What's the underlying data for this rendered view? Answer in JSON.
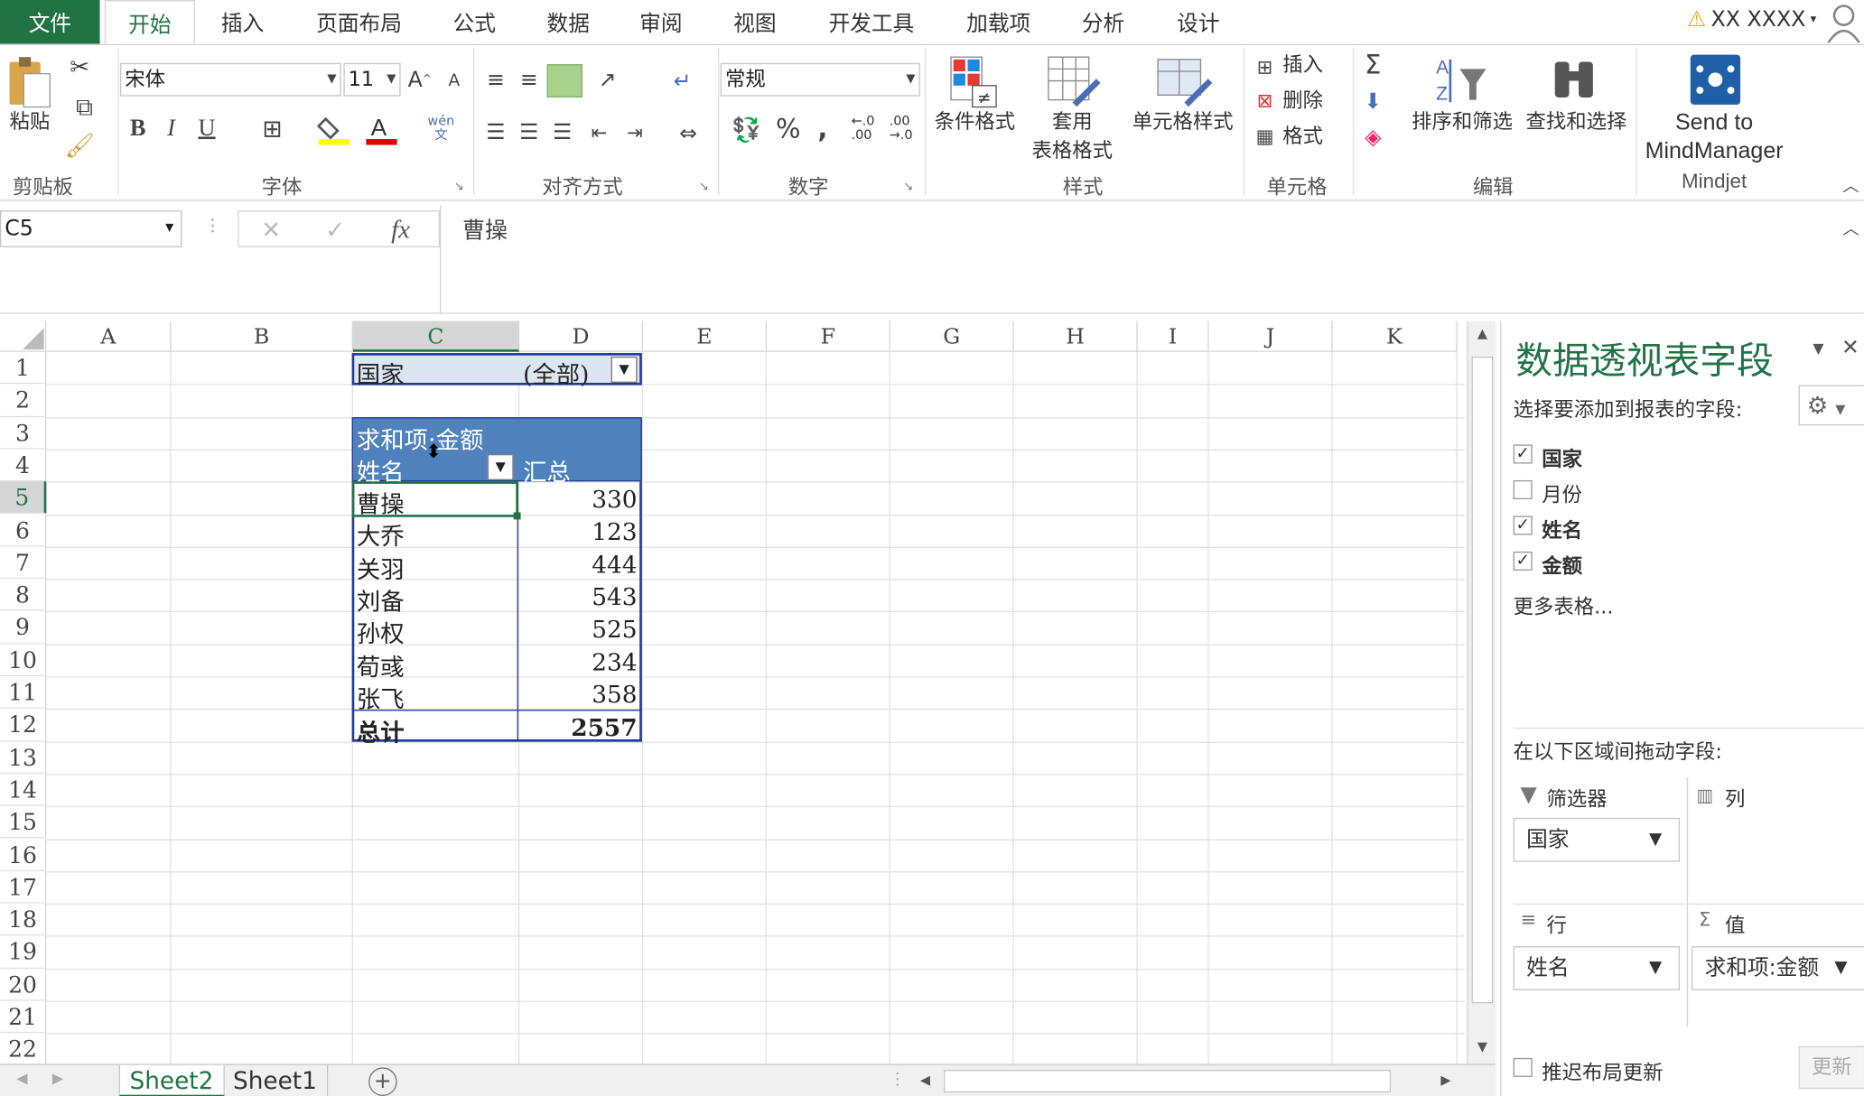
{
  "tabs": {
    "file": "文件",
    "items": [
      "开始",
      "插入",
      "页面布局",
      "公式",
      "数据",
      "审阅",
      "视图",
      "开发工具",
      "加载项",
      "分析",
      "设计"
    ],
    "active": "开始"
  },
  "user": {
    "name": "XX XXXX",
    "warning_icon": "warning-icon"
  },
  "ribbon": {
    "clipboard": {
      "paste": "粘贴",
      "label": "剪贴板"
    },
    "font": {
      "name": "宋体",
      "size": "11",
      "label": "字体",
      "bold": "B",
      "italic": "I",
      "underline": "U",
      "phonetic": "wén\n文"
    },
    "alignment": {
      "label": "对齐方式"
    },
    "number": {
      "format": "常规",
      "label": "数字",
      "percent": "%",
      "comma": ",",
      "inc_decimal": "←.0\n.00",
      "dec_decimal": ".00\n→.0"
    },
    "styles": {
      "conditional": "条件格式",
      "table_format_1": "套用",
      "table_format_2": "表格格式",
      "cell_styles": "单元格样式",
      "label": "样式"
    },
    "cells": {
      "insert": "插入",
      "delete": "删除",
      "format": "格式",
      "label": "单元格"
    },
    "editing": {
      "sort_filter": "排序和筛选",
      "find_select": "查找和选择",
      "label": "编辑",
      "sigma": "Σ"
    },
    "mindjet": {
      "send_1": "Send to",
      "send_2": "MindManager",
      "label": "Mindjet"
    }
  },
  "formula_bar": {
    "name_box": "C5",
    "fx": "fx",
    "value": "曹操"
  },
  "columns": [
    "A",
    "B",
    "C",
    "D",
    "E",
    "F",
    "G",
    "H",
    "I",
    "J",
    "K"
  ],
  "rows": [
    "1",
    "2",
    "3",
    "4",
    "5",
    "6",
    "7",
    "8",
    "9",
    "10",
    "11",
    "12",
    "13",
    "14",
    "15",
    "16",
    "17",
    "18",
    "19",
    "20",
    "21",
    "22"
  ],
  "pivot": {
    "filter_field": "国家",
    "filter_value": "(全部)",
    "value_header": "求和项:金额",
    "row_header": "姓名",
    "total_header": "汇总",
    "rows": [
      {
        "name": "曹操",
        "value": "330"
      },
      {
        "name": "大乔",
        "value": "123"
      },
      {
        "name": "关羽",
        "value": "444"
      },
      {
        "name": "刘备",
        "value": "543"
      },
      {
        "name": "孙权",
        "value": "525"
      },
      {
        "name": "荀彧",
        "value": "234"
      },
      {
        "name": "张飞",
        "value": "358"
      }
    ],
    "grand_total_label": "总计",
    "grand_total_value": "2557"
  },
  "sheets": [
    "Sheet2",
    "Sheet1"
  ],
  "pane": {
    "title": "数据透视表字段",
    "choose_label": "选择要添加到报表的字段:",
    "fields": [
      {
        "name": "国家",
        "checked": true
      },
      {
        "name": "月份",
        "checked": false
      },
      {
        "name": "姓名",
        "checked": true
      },
      {
        "name": "金额",
        "checked": true
      }
    ],
    "more_tables": "更多表格...",
    "drag_label": "在以下区域间拖动字段:",
    "filters_label": "筛选器",
    "columns_label": "列",
    "rows_label": "行",
    "values_label": "值",
    "filters_value": "国家",
    "rows_value": "姓名",
    "values_value": "求和项:金额",
    "defer_label": "推迟布局更新",
    "update_label": "更新"
  },
  "colors": {
    "accent": "#217346",
    "pivot_header": "#4f81bd",
    "pivot_filter": "#dce6f1",
    "pivot_border": "#1f3b99"
  }
}
